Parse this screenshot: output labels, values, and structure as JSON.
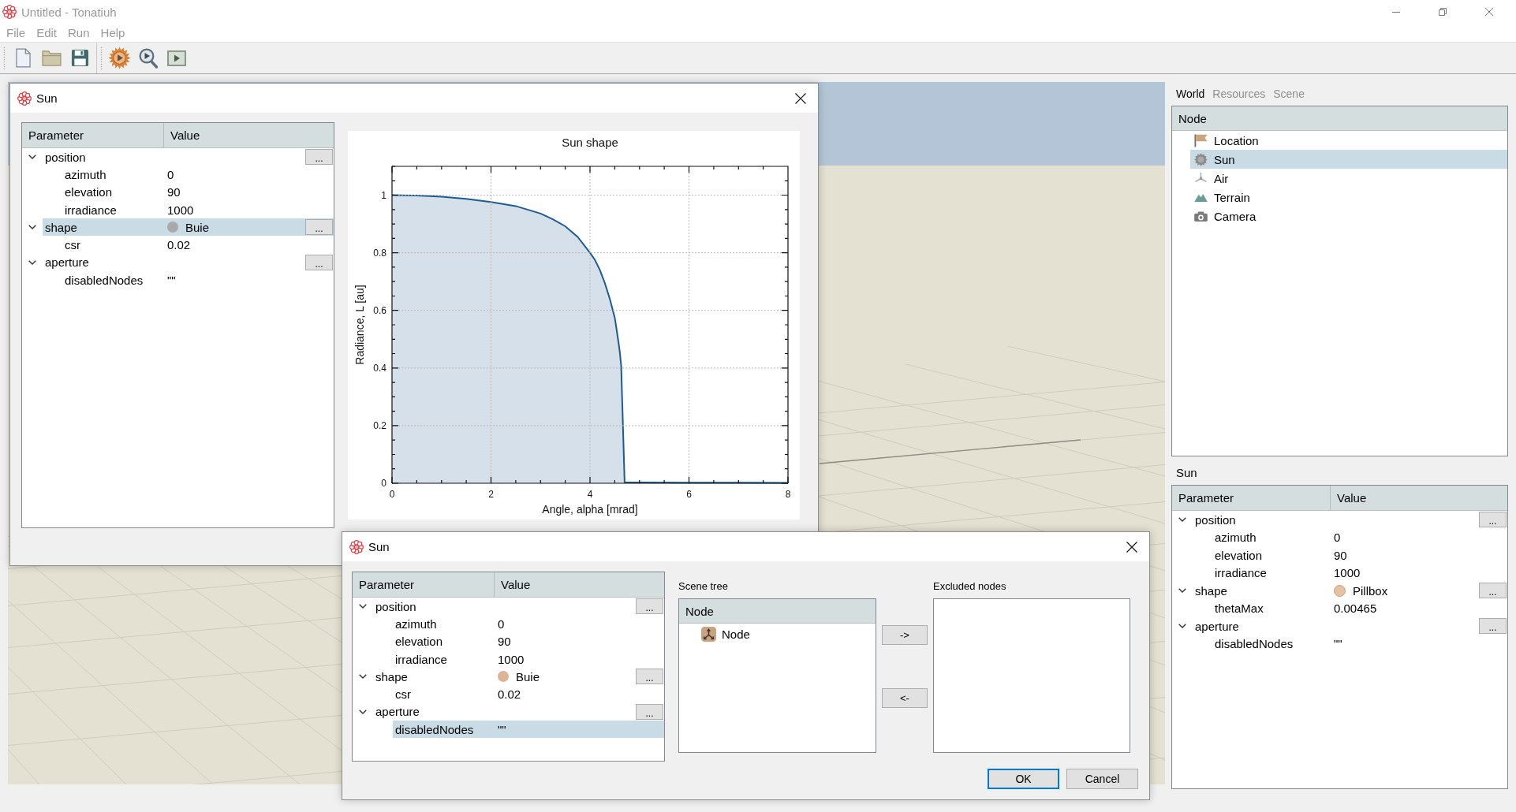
{
  "window": {
    "title": "Untitled - Tonatiuh"
  },
  "menu": [
    {
      "label": "File"
    },
    {
      "label": "Edit"
    },
    {
      "label": "Run"
    },
    {
      "label": "Help"
    }
  ],
  "viewer_dialog": {
    "title": "Sun",
    "parameters": {
      "columns": [
        "Parameter",
        "Value"
      ],
      "rows": [
        {
          "name": "position",
          "expanded": true,
          "selected": false,
          "action": "...",
          "children": [
            {
              "name": "azimuth",
              "value": "0",
              "selected": false
            },
            {
              "name": "elevation",
              "value": "90",
              "selected": false
            },
            {
              "name": "irradiance",
              "value": "1000",
              "selected": false
            }
          ]
        },
        {
          "name": "shape",
          "value": "Buie",
          "color": "#a9a9a9",
          "expanded": true,
          "selected": true,
          "action": "...",
          "children": [
            {
              "name": "csr",
              "value": "0.02",
              "selected": false
            }
          ]
        },
        {
          "name": "aperture",
          "expanded": true,
          "selected": false,
          "action": "...",
          "children": [
            {
              "name": "disabledNodes",
              "value": "\"\"",
              "selected": false
            }
          ]
        }
      ]
    },
    "chart": {
      "chart_data": {
        "type": "area",
        "title": "Sun shape",
        "xlabel": "Angle, alpha [mrad]",
        "ylabel": "Radiance, L [au]",
        "x": [
          0,
          0.5,
          1,
          1.5,
          2,
          2.5,
          3,
          3.25,
          3.5,
          3.75,
          4,
          4.1,
          4.2,
          4.3,
          4.4,
          4.5,
          4.55,
          4.6,
          4.63,
          4.7,
          5,
          6,
          7,
          8
        ],
        "series": [
          {
            "color": "#1f5b8e",
            "values": [
              1,
              0.999,
              0.995,
              0.987,
              0.976,
              0.962,
              0.936,
              0.916,
              0.892,
              0.855,
              0.8,
              0.775,
              0.74,
              0.695,
              0.64,
              0.575,
              0.52,
              0.46,
              0.41,
              0.003,
              0.003,
              0.002,
              0.002,
              0.001
            ]
          }
        ],
        "xlim": [
          0,
          8
        ],
        "ylim": [
          0,
          1.1
        ],
        "xticks": [
          0,
          2,
          4,
          6,
          8
        ],
        "yticks": [
          0,
          0.2,
          0.4,
          0.6,
          0.8,
          1
        ],
        "grid": true
      }
    }
  },
  "editor_dialog": {
    "title": "Sun",
    "parameters": {
      "columns": [
        "Parameter",
        "Value"
      ],
      "rows": [
        {
          "name": "position",
          "expanded": true,
          "selected": false,
          "action": "...",
          "children": [
            {
              "name": "azimuth",
              "value": "0",
              "selected": false
            },
            {
              "name": "elevation",
              "value": "90",
              "selected": false
            },
            {
              "name": "irradiance",
              "value": "1000",
              "selected": false
            }
          ]
        },
        {
          "name": "shape",
          "value": "Buie",
          "color": "#dcb496",
          "expanded": true,
          "selected": false,
          "action": "...",
          "children": [
            {
              "name": "csr",
              "value": "0.02",
              "selected": false
            }
          ]
        },
        {
          "name": "aperture",
          "expanded": true,
          "selected": false,
          "action": "...",
          "children": [
            {
              "name": "disabledNodes",
              "value": "\"\"",
              "selected": true
            }
          ]
        }
      ]
    },
    "scene_tree": {
      "label": "Scene tree",
      "columns": [
        "Node"
      ],
      "items": [
        {
          "label": "Node",
          "kind": "group",
          "selected": false
        }
      ]
    },
    "move_buttons": [
      {
        "label": "->"
      },
      {
        "label": "<-"
      }
    ],
    "excluded_nodes": {
      "label": "Excluded nodes"
    },
    "buttons": [
      {
        "label": "OK",
        "default": true
      },
      {
        "label": "Cancel",
        "default": false
      }
    ]
  },
  "side_panel": {
    "tabs": [
      {
        "label": "World",
        "selected": true
      },
      {
        "label": "Resources",
        "selected": false
      },
      {
        "label": "Scene",
        "selected": false
      }
    ],
    "node_tree": {
      "columns": [
        "Node"
      ],
      "items": [
        {
          "label": "Location",
          "kind": "location",
          "selected": false
        },
        {
          "label": "Sun",
          "kind": "sun",
          "selected": true
        },
        {
          "label": "Air",
          "kind": "air",
          "selected": false
        },
        {
          "label": "Terrain",
          "kind": "terrain",
          "selected": false
        },
        {
          "label": "Camera",
          "kind": "camera",
          "selected": false
        }
      ]
    },
    "parameters_title": "Sun",
    "parameters": {
      "columns": [
        "Parameter",
        "Value"
      ],
      "rows": [
        {
          "name": "position",
          "expanded": true,
          "selected": false,
          "action": "...",
          "children": [
            {
              "name": "azimuth",
              "value": "0",
              "selected": false
            },
            {
              "name": "elevation",
              "value": "90",
              "selected": false
            },
            {
              "name": "irradiance",
              "value": "1000",
              "selected": false
            }
          ]
        },
        {
          "name": "shape",
          "value": "Pillbox",
          "color": "#e6c2a4",
          "expanded": true,
          "selected": false,
          "action": "...",
          "children": [
            {
              "name": "thetaMax",
              "value": "0.00465",
              "selected": false
            }
          ]
        },
        {
          "name": "aperture",
          "expanded": true,
          "selected": false,
          "action": "...",
          "children": [
            {
              "name": "disabledNodes",
              "value": "\"\"",
              "selected": false
            }
          ]
        }
      ]
    }
  }
}
